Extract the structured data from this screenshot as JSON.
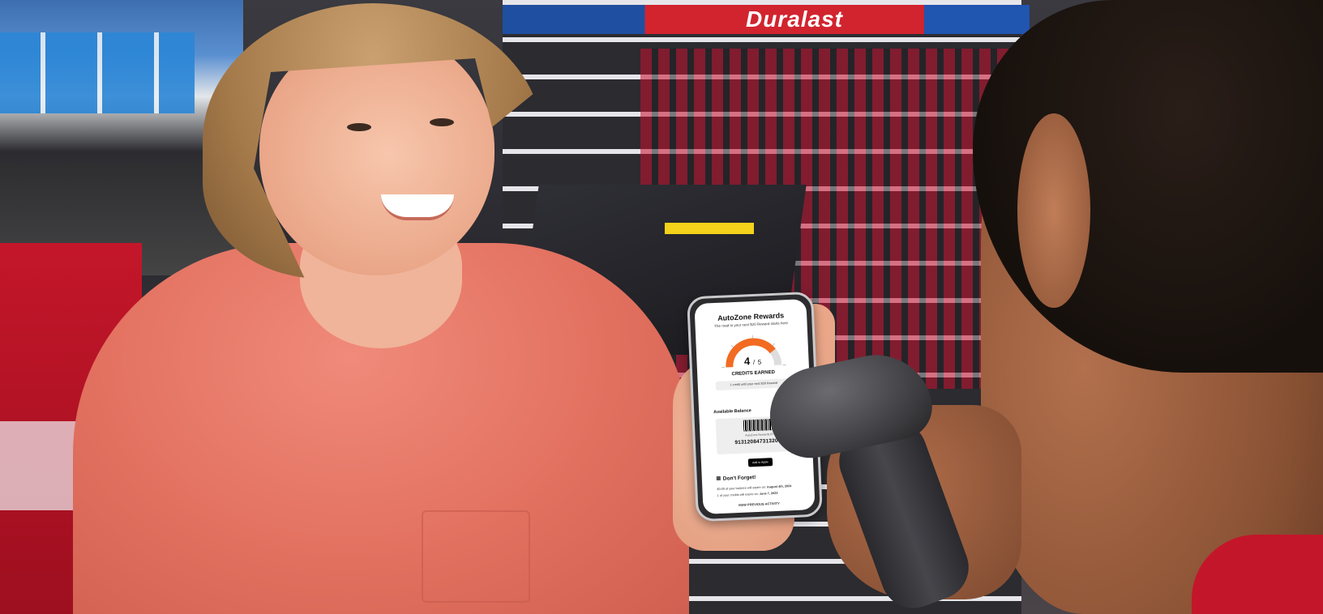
{
  "store": {
    "banner_text": "Duralast"
  },
  "phone": {
    "app_title": "AutoZone Rewards",
    "subtitle": "The road to your next $20 Reward starts here",
    "credits_current": "4",
    "credits_separator": "/",
    "credits_total": "5",
    "credits_label": "CREDITS EARNED",
    "credit_note": "1 credit until your next $20 Reward",
    "balance_label": "Available Balance",
    "barcode_caption": "AutoZone Rewards ID",
    "member_id": "9131208473132000",
    "wallet_button": "Add to Apple Wallet",
    "dont_forget": "Don't Forget!",
    "expire_balance_prefix": "$0.00 of your balance will expire on:",
    "expire_balance_date": "August 4th, 2024",
    "expire_credits_prefix": "1 of your credits will expire on:",
    "expire_credits_date": "June 7, 2023",
    "view_activity": "VIEW PREVIOUS ACTIVITY"
  },
  "gauge": {
    "progress_fraction": 0.8,
    "fill_color": "#f26b21",
    "track_color": "#dddddd"
  }
}
